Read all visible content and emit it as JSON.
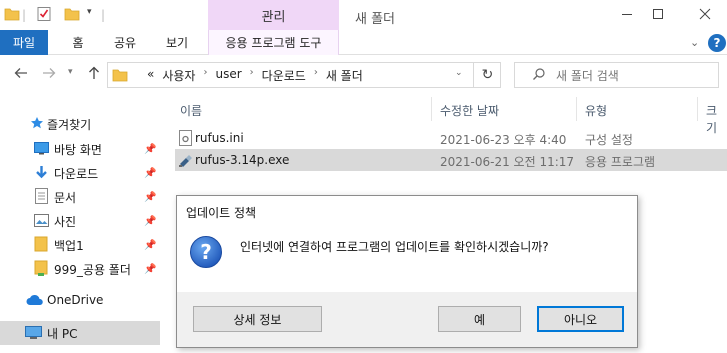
{
  "window": {
    "title": "새 폴더",
    "manage_tab": "관리"
  },
  "ribbon": {
    "tabs": [
      "파일",
      "홈",
      "공유",
      "보기",
      "응용 프로그램 도구"
    ]
  },
  "address": {
    "prefix": "«",
    "crumbs": [
      "사용자",
      "user",
      "다운로드",
      "새 폴더"
    ]
  },
  "search": {
    "placeholder": "새 폴더 검색"
  },
  "nav": {
    "quick_access": "즐겨찾기",
    "items": [
      {
        "label": "바탕 화면",
        "icon": "desktop-icon"
      },
      {
        "label": "다운로드",
        "icon": "download-icon"
      },
      {
        "label": "문서",
        "icon": "document-icon"
      },
      {
        "label": "사진",
        "icon": "pictures-icon"
      },
      {
        "label": "백업1",
        "icon": "folder-icon"
      },
      {
        "label": "999_공용 폴더",
        "icon": "folder-icon"
      }
    ],
    "onedrive": "OneDrive",
    "this_pc": "내 PC"
  },
  "columns": [
    "이름",
    "수정한 날짜",
    "유형",
    "크기"
  ],
  "files": [
    {
      "name": "rufus.ini",
      "date": "2021-06-23 오후 4:40",
      "type": "구성 설정",
      "icon": "settings-file-icon"
    },
    {
      "name": "rufus-3.14p.exe",
      "date": "2021-06-21 오전 11:17",
      "type": "응용 프로그램",
      "icon": "usb-drive-icon"
    }
  ],
  "dialog": {
    "title": "업데이트 정책",
    "message": "인터넷에 연결하여 프로그램의 업데이트를 확인하시겠습니까?",
    "buttons": {
      "details": "상세 정보",
      "yes": "예",
      "no": "아니오"
    }
  }
}
